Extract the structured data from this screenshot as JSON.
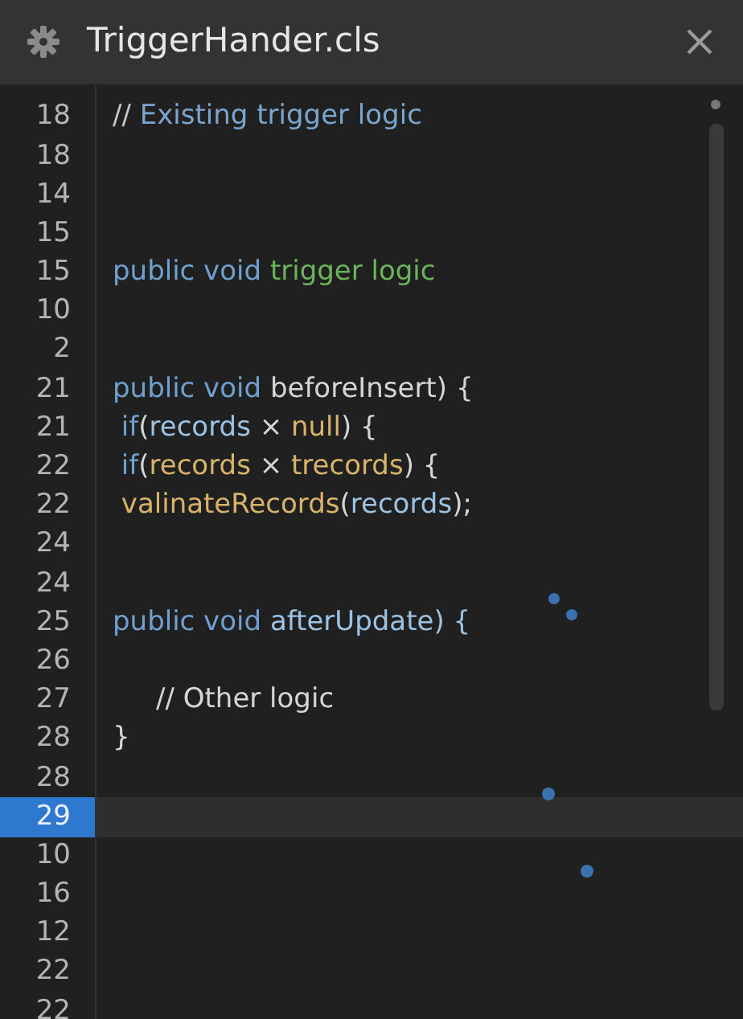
{
  "window": {
    "title": "TriggerHander.cls"
  },
  "lines": [
    {
      "number": "18",
      "selected": false,
      "tokens": [
        {
          "kind": "punct",
          "text": "//"
        },
        {
          "kind": "comment",
          "text": " Existing trigger logic"
        }
      ]
    },
    {
      "number": "18",
      "selected": false
    },
    {
      "number": "14",
      "selected": false
    },
    {
      "number": "15",
      "selected": false
    },
    {
      "number": "15",
      "selected": false,
      "tokens": [
        {
          "kind": "keyword",
          "text": "public void "
        },
        {
          "kind": "method",
          "text": "trigger logic"
        }
      ]
    },
    {
      "number": "10",
      "selected": false
    },
    {
      "number": "2",
      "selected": false
    },
    {
      "number": "21",
      "selected": false,
      "tokens": [
        {
          "kind": "keyword",
          "text": "public void "
        },
        {
          "kind": "plain",
          "text": "beforeInsert) {"
        }
      ]
    },
    {
      "number": "21",
      "selected": false,
      "tokens": [
        {
          "kind": "keyword",
          "text": " if"
        },
        {
          "kind": "plain",
          "text": "("
        },
        {
          "kind": "variable",
          "text": "records"
        },
        {
          "kind": "plain",
          "text": " × "
        },
        {
          "kind": "literal",
          "text": "null"
        },
        {
          "kind": "plain",
          "text": ") {"
        }
      ]
    },
    {
      "number": "22",
      "selected": false,
      "tokens": [
        {
          "kind": "keyword",
          "text": " if"
        },
        {
          "kind": "plain",
          "text": "("
        },
        {
          "kind": "literal",
          "text": "records"
        },
        {
          "kind": "plain",
          "text": " × "
        },
        {
          "kind": "literal",
          "text": "trecords"
        },
        {
          "kind": "plain",
          "text": ") {"
        }
      ]
    },
    {
      "number": "22",
      "selected": false,
      "tokens": [
        {
          "kind": "literal",
          "text": " valinateRecords"
        },
        {
          "kind": "plain",
          "text": "("
        },
        {
          "kind": "variable",
          "text": "records"
        },
        {
          "kind": "plain",
          "text": ");"
        }
      ]
    },
    {
      "number": "24",
      "selected": false
    },
    {
      "number": "24",
      "selected": false
    },
    {
      "number": "25",
      "selected": false,
      "tokens": [
        {
          "kind": "keyword",
          "text": "public void "
        },
        {
          "kind": "variable",
          "text": "afterUpdate) {"
        }
      ]
    },
    {
      "number": "26",
      "selected": false
    },
    {
      "number": "27",
      "selected": false,
      "tokens": [
        {
          "kind": "plain",
          "text": "     // Other logic"
        }
      ]
    },
    {
      "number": "28",
      "selected": false,
      "tokens": [
        {
          "kind": "plain",
          "text": "}"
        }
      ]
    },
    {
      "number": "28",
      "selected": false
    },
    {
      "number": "29",
      "selected": true
    },
    {
      "number": "10",
      "selected": false
    },
    {
      "number": "16",
      "selected": false
    },
    {
      "number": "12",
      "selected": false
    },
    {
      "number": "22",
      "selected": false
    },
    {
      "number": "22",
      "selected": false
    }
  ]
}
